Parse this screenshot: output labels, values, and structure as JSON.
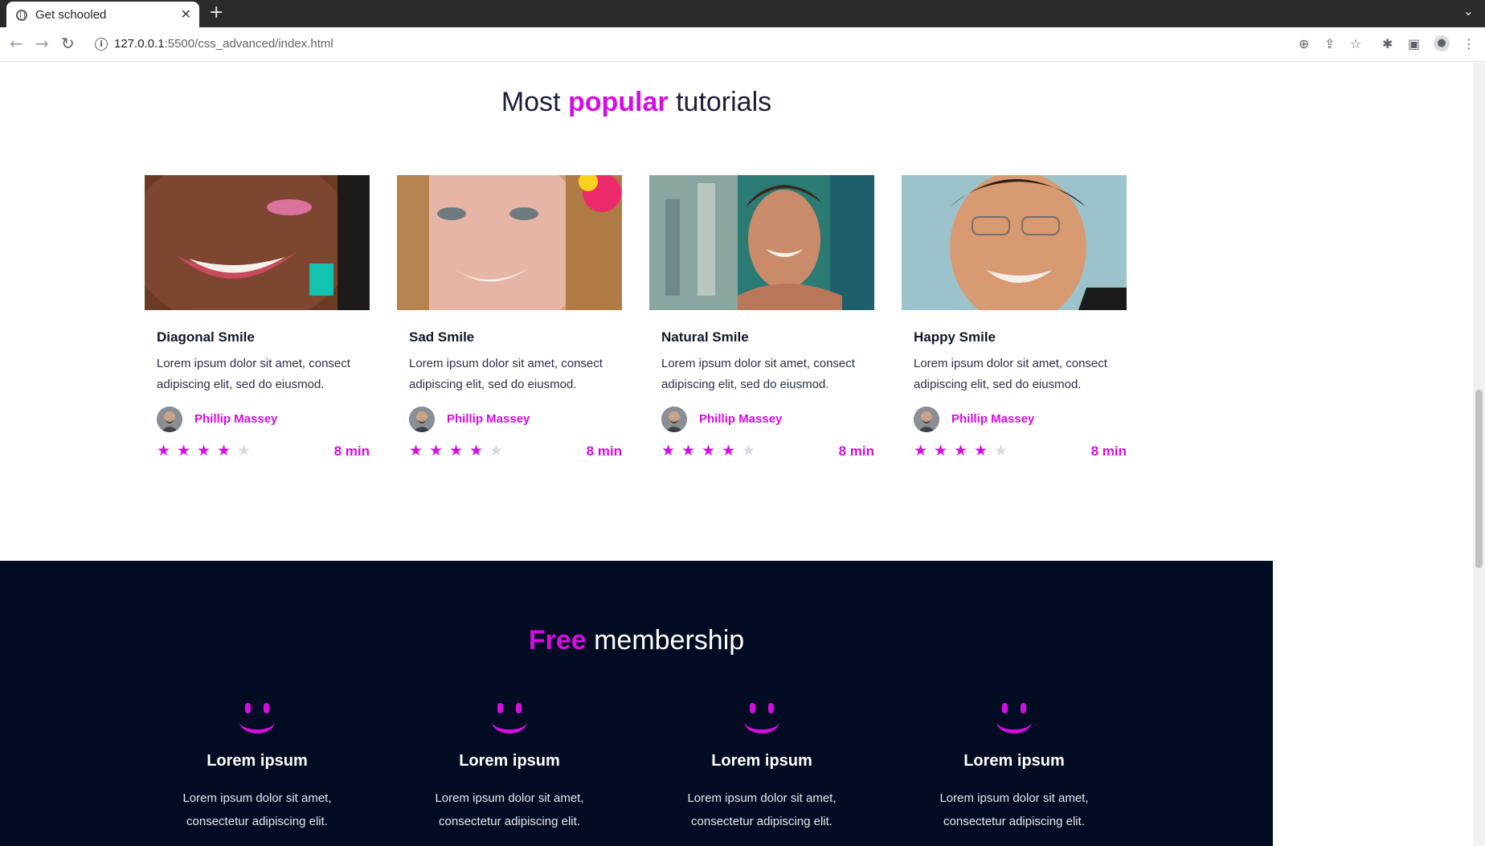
{
  "browser": {
    "tab_title": "Get schooled",
    "url_host": "127.0.0.1",
    "url_path": ":5500/css_advanced/index.html"
  },
  "popular": {
    "title_before": "Most",
    "title_accent": "popular",
    "title_after": "tutorials",
    "cards": [
      {
        "title": "Diagonal Smile",
        "desc": "Lorem ipsum dolor sit amet, consect adipiscing elit, sed do eiusmod.",
        "author": "Phillip Massey",
        "rating": 4,
        "rating_max": 5,
        "duration": "8 min"
      },
      {
        "title": "Sad Smile",
        "desc": "Lorem ipsum dolor sit amet, consect adipiscing elit, sed do eiusmod.",
        "author": "Phillip Massey",
        "rating": 4,
        "rating_max": 5,
        "duration": "8 min"
      },
      {
        "title": "Natural Smile",
        "desc": "Lorem ipsum dolor sit amet, consect adipiscing elit, sed do eiusmod.",
        "author": "Phillip Massey",
        "rating": 4,
        "rating_max": 5,
        "duration": "8 min"
      },
      {
        "title": "Happy Smile",
        "desc": "Lorem ipsum dolor sit amet, consect adipiscing elit, sed do eiusmod.",
        "author": "Phillip Massey",
        "rating": 4,
        "rating_max": 5,
        "duration": "8 min"
      }
    ]
  },
  "membership": {
    "title_accent": "Free",
    "title_after": "membership",
    "items": [
      {
        "title": "Lorem ipsum",
        "desc_line1": "Lorem ipsum dolor sit amet,",
        "desc_line2": "consectetur adipiscing elit."
      },
      {
        "title": "Lorem ipsum",
        "desc_line1": "Lorem ipsum dolor sit amet,",
        "desc_line2": "consectetur adipiscing elit."
      },
      {
        "title": "Lorem ipsum",
        "desc_line1": "Lorem ipsum dolor sit amet,",
        "desc_line2": "consectetur adipiscing elit."
      },
      {
        "title": "Lorem ipsum",
        "desc_line1": "Lorem ipsum dolor sit amet,",
        "desc_line2": "consectetur adipiscing elit."
      }
    ]
  },
  "colors": {
    "accent": "#d30ee0",
    "dark_navy": "#040c24",
    "heading_text": "#1a1f36"
  },
  "icons": [
    "globe-icon",
    "close-icon",
    "plus-icon",
    "chevron-down-icon",
    "back-arrow-icon",
    "forward-arrow-icon",
    "reload-icon",
    "info-icon",
    "zoom-icon",
    "share-icon",
    "star-bookmark-icon",
    "puzzle-extensions-icon",
    "side-panel-icon",
    "profile-icon",
    "kebab-menu-icon",
    "rating-star-icon",
    "smile-icon"
  ]
}
